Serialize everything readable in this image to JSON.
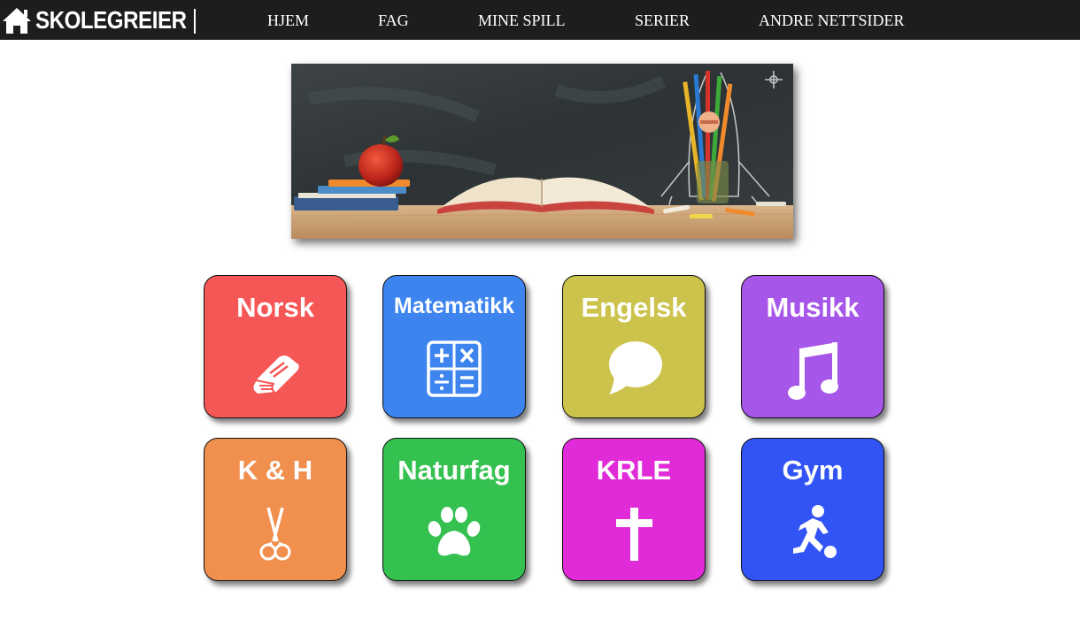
{
  "header": {
    "logo_text": "SKOLEGREIER",
    "logo_icon": "home-icon",
    "nav": [
      "HJEM",
      "FAG",
      "MINE SPILL",
      "SERIER",
      "ANDRE NETTSIDER"
    ]
  },
  "subjects": [
    {
      "label": "Norsk",
      "icon": "book-icon",
      "color": "#f55656"
    },
    {
      "label": "Matematikk",
      "icon": "calculator-icon",
      "color": "#3d84ef"
    },
    {
      "label": "Engelsk",
      "icon": "speech-bubble-icon",
      "color": "#cbc34b"
    },
    {
      "label": "Musikk",
      "icon": "music-note-icon",
      "color": "#a656e8"
    },
    {
      "label": "K & H",
      "icon": "scissors-icon",
      "color": "#f08f4e"
    },
    {
      "label": "Naturfag",
      "icon": "paw-icon",
      "color": "#34c150"
    },
    {
      "label": "KRLE",
      "icon": "cross-icon",
      "color": "#e12ad8"
    },
    {
      "label": "Gym",
      "icon": "soccer-player-icon",
      "color": "#3254f5"
    }
  ]
}
